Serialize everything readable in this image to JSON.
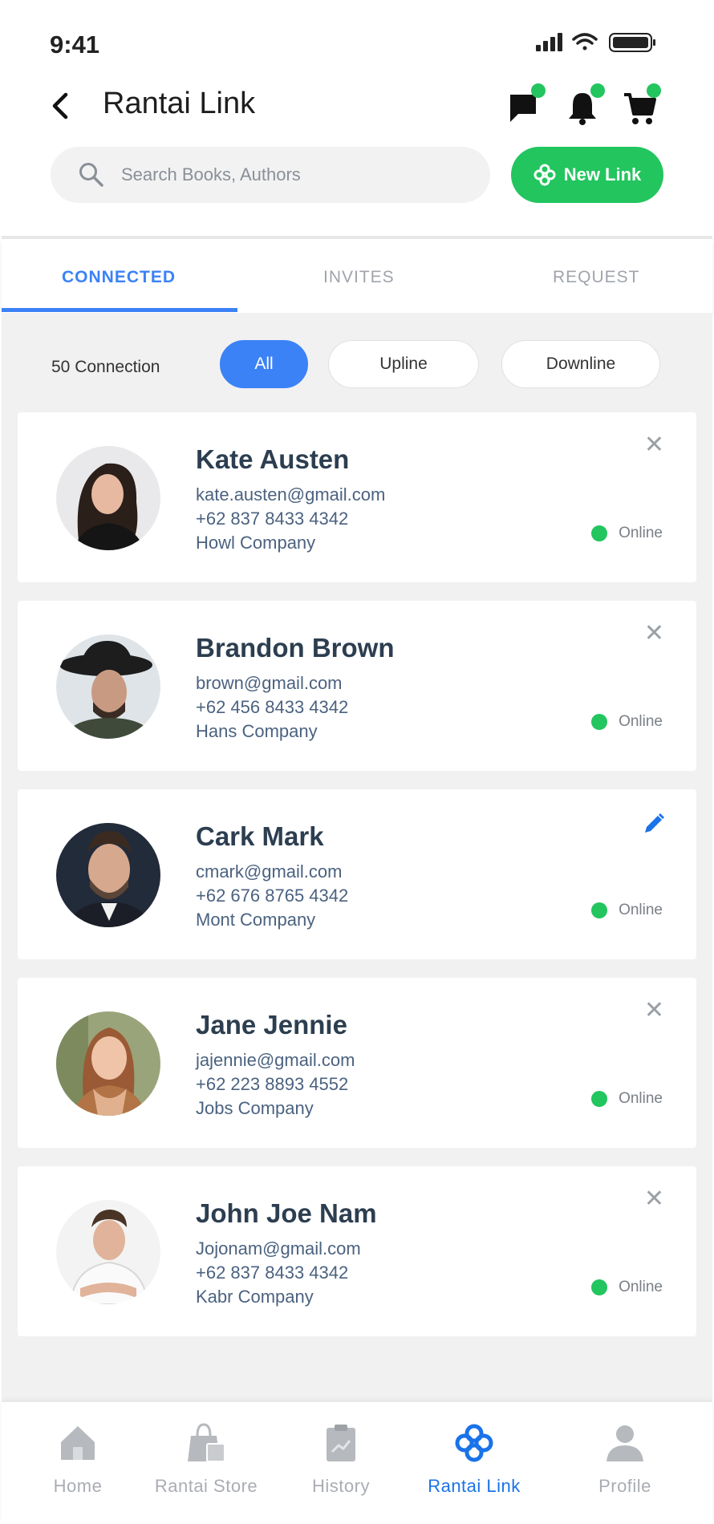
{
  "status_bar": {
    "time": "9:41"
  },
  "header": {
    "title": "Rantai Link"
  },
  "search": {
    "placeholder": "Search Books, Authors"
  },
  "new_link_button": {
    "label": "New Link"
  },
  "tabs": [
    {
      "label": "CONNECTED",
      "active": true
    },
    {
      "label": "INVITES",
      "active": false
    },
    {
      "label": "REQUEST",
      "active": false
    }
  ],
  "filter": {
    "count_label": "50 Connection",
    "chips": [
      {
        "label": "All",
        "active": true
      },
      {
        "label": "Upline",
        "active": false
      },
      {
        "label": "Downline",
        "active": false
      }
    ]
  },
  "connections": [
    {
      "name": "Kate Austen",
      "email": "kate.austen@gmail.com",
      "phone": "+62 837 8433 4342",
      "company": "Howl Company",
      "status": "Online",
      "action": "close-icon"
    },
    {
      "name": "Brandon Brown",
      "email": "brown@gmail.com",
      "phone": "+62 456 8433 4342",
      "company": "Hans Company",
      "status": "Online",
      "action": "close-icon"
    },
    {
      "name": "Cark Mark",
      "email": "cmark@gmail.com",
      "phone": "+62 676 8765 4342",
      "company": "Mont Company",
      "status": "Online",
      "action": "edit-icon"
    },
    {
      "name": "Jane Jennie",
      "email": "jajennie@gmail.com",
      "phone": "+62 223 8893 4552",
      "company": "Jobs Company",
      "status": "Online",
      "action": "close-icon"
    },
    {
      "name": "John Joe Nam",
      "email": "Jojonam@gmail.com",
      "phone": "+62 837 8433 4342",
      "company": "Kabr Company",
      "status": "Online",
      "action": "close-icon"
    }
  ],
  "bottom_nav": [
    {
      "label": "Home",
      "icon": "home-icon",
      "active": false
    },
    {
      "label": "Rantai Store",
      "icon": "store-icon",
      "active": false
    },
    {
      "label": "History",
      "icon": "history-icon",
      "active": false
    },
    {
      "label": "Rantai Link",
      "icon": "rantai-link-icon",
      "active": true
    },
    {
      "label": "Profile",
      "icon": "profile-icon",
      "active": false
    }
  ],
  "colors": {
    "accent_blue": "#3b82f6",
    "nav_active": "#1a73e8",
    "green": "#22c55e",
    "background_gray": "#f1f1f1"
  }
}
